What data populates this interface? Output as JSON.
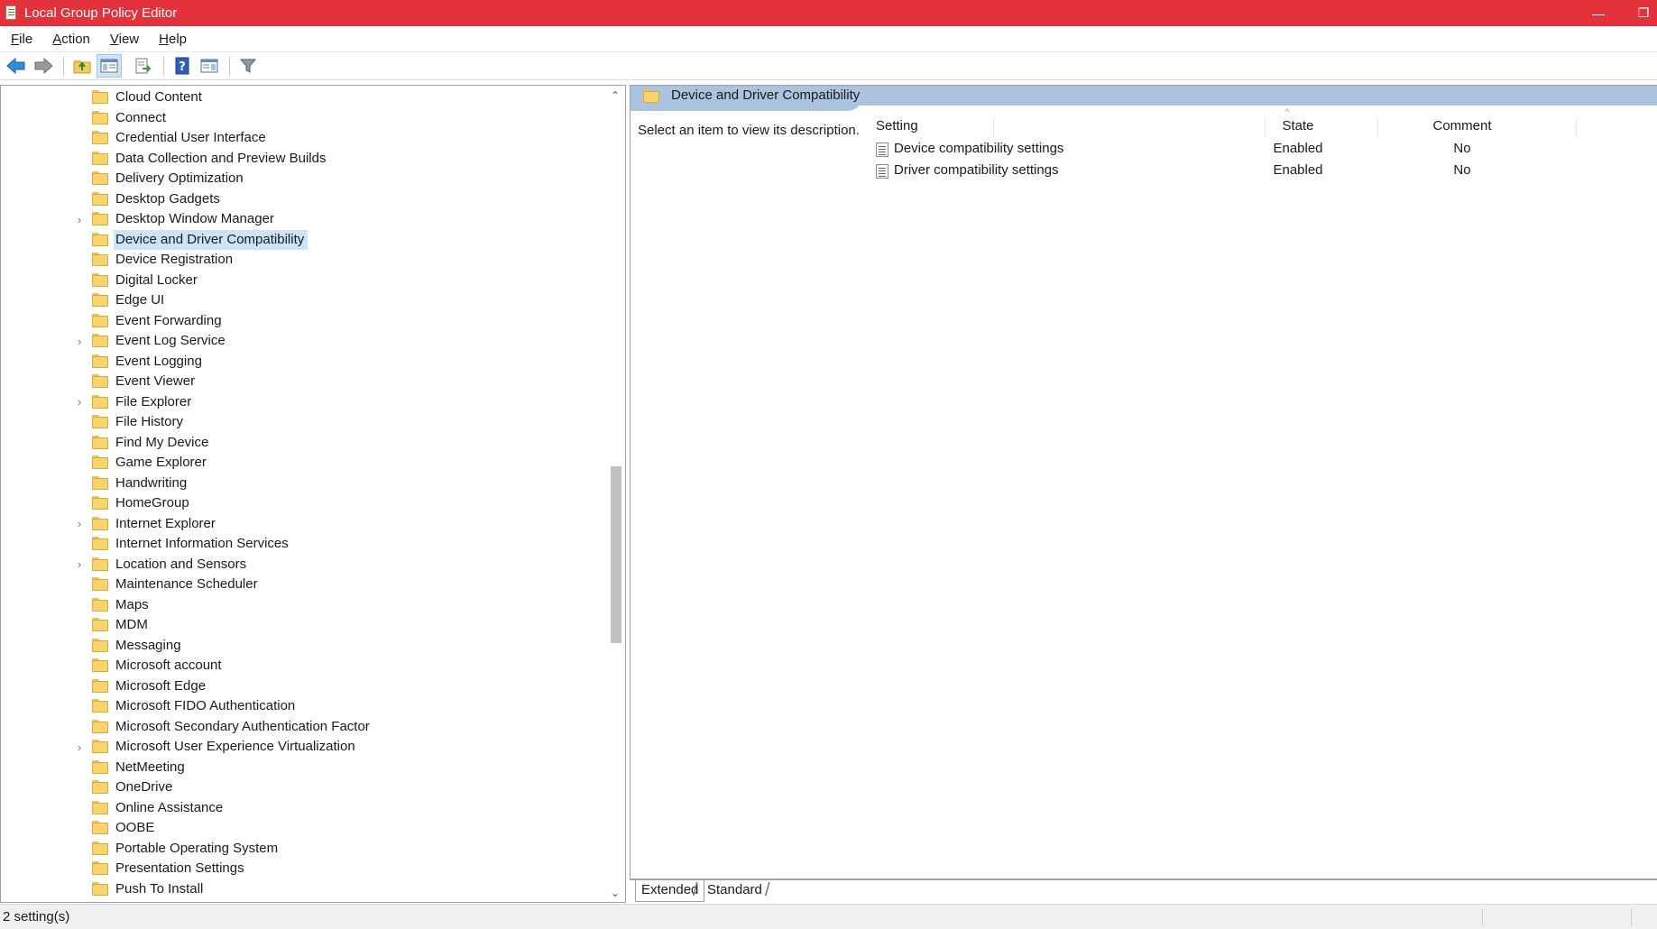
{
  "window": {
    "title": "Local Group Policy Editor",
    "accent_color": "#e3323b",
    "minimize_glyph": "—",
    "restore_glyph": "❐"
  },
  "menu": [
    {
      "label": "File",
      "hotkey": "F",
      "rest": "ile"
    },
    {
      "label": "Action",
      "hotkey": "A",
      "rest": "ction"
    },
    {
      "label": "View",
      "hotkey": "V",
      "rest": "iew"
    },
    {
      "label": "Help",
      "hotkey": "H",
      "rest": "elp"
    }
  ],
  "toolbar": {
    "buttons": [
      "back-arrow-icon",
      "forward-arrow-icon",
      "up-folder-icon",
      "show-hide-tree-icon",
      "export-list-icon",
      "help-icon",
      "show-hide-action-pane-icon",
      "filter-icon"
    ]
  },
  "tree": {
    "selected": "Device and Driver Compatibility",
    "items": [
      {
        "label": "Cloud Content",
        "expandable": false
      },
      {
        "label": "Connect",
        "expandable": false
      },
      {
        "label": "Credential User Interface",
        "expandable": false
      },
      {
        "label": "Data Collection and Preview Builds",
        "expandable": false
      },
      {
        "label": "Delivery Optimization",
        "expandable": false
      },
      {
        "label": "Desktop Gadgets",
        "expandable": false
      },
      {
        "label": "Desktop Window Manager",
        "expandable": true
      },
      {
        "label": "Device and Driver Compatibility",
        "expandable": false
      },
      {
        "label": "Device Registration",
        "expandable": false
      },
      {
        "label": "Digital Locker",
        "expandable": false
      },
      {
        "label": "Edge UI",
        "expandable": false
      },
      {
        "label": "Event Forwarding",
        "expandable": false
      },
      {
        "label": "Event Log Service",
        "expandable": true
      },
      {
        "label": "Event Logging",
        "expandable": false
      },
      {
        "label": "Event Viewer",
        "expandable": false
      },
      {
        "label": "File Explorer",
        "expandable": true
      },
      {
        "label": "File History",
        "expandable": false
      },
      {
        "label": "Find My Device",
        "expandable": false
      },
      {
        "label": "Game Explorer",
        "expandable": false
      },
      {
        "label": "Handwriting",
        "expandable": false
      },
      {
        "label": "HomeGroup",
        "expandable": false
      },
      {
        "label": "Internet Explorer",
        "expandable": true
      },
      {
        "label": "Internet Information Services",
        "expandable": false
      },
      {
        "label": "Location and Sensors",
        "expandable": true
      },
      {
        "label": "Maintenance Scheduler",
        "expandable": false
      },
      {
        "label": "Maps",
        "expandable": false
      },
      {
        "label": "MDM",
        "expandable": false
      },
      {
        "label": "Messaging",
        "expandable": false
      },
      {
        "label": "Microsoft account",
        "expandable": false
      },
      {
        "label": "Microsoft Edge",
        "expandable": false
      },
      {
        "label": "Microsoft FIDO Authentication",
        "expandable": false
      },
      {
        "label": "Microsoft Secondary Authentication Factor",
        "expandable": false
      },
      {
        "label": "Microsoft User Experience Virtualization",
        "expandable": true
      },
      {
        "label": "NetMeeting",
        "expandable": false
      },
      {
        "label": "OneDrive",
        "expandable": false
      },
      {
        "label": "Online Assistance",
        "expandable": false
      },
      {
        "label": "OOBE",
        "expandable": false
      },
      {
        "label": "Portable Operating System",
        "expandable": false
      },
      {
        "label": "Presentation Settings",
        "expandable": false
      },
      {
        "label": "Push To Install",
        "expandable": false
      }
    ]
  },
  "right_pane": {
    "header_title": "Device and Driver Compatibility",
    "description": "Select an item to view its description.",
    "columns": {
      "setting": "Setting",
      "state": "State",
      "comment": "Comment"
    },
    "rows": [
      {
        "setting": "Device compatibility settings",
        "state": "Enabled",
        "comment": "No"
      },
      {
        "setting": "Driver compatibility settings",
        "state": "Enabled",
        "comment": "No"
      }
    ]
  },
  "tabs": {
    "extended": "Extended",
    "standard": "Standard"
  },
  "status": {
    "text": "2 setting(s)"
  }
}
